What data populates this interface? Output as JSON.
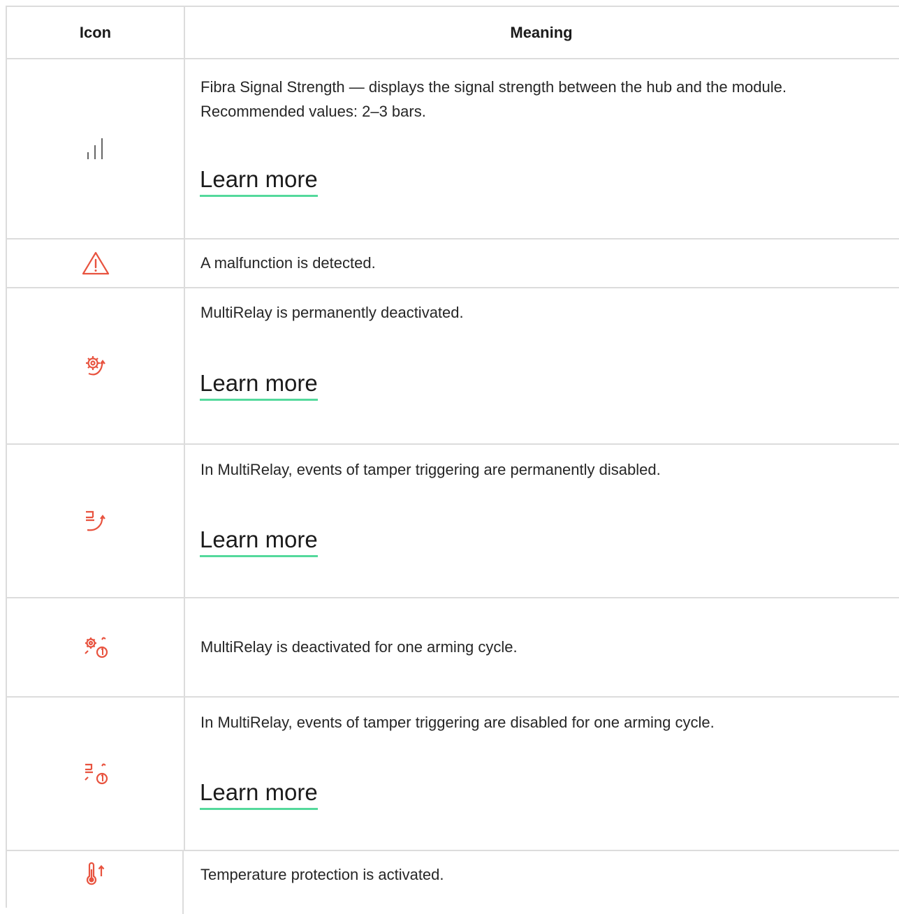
{
  "table": {
    "header": {
      "icon": "Icon",
      "meaning": "Meaning"
    },
    "rows": [
      {
        "icon": "signal-strength-icon",
        "text": "Fibra Signal Strength — displays the signal strength between the hub and the module. Recommended values: 2–3 bars.",
        "link": "Learn more"
      },
      {
        "icon": "warning-triangle-icon",
        "text": "A malfunction is detected."
      },
      {
        "icon": "gear-deactivated-icon",
        "text": "MultiRelay is permanently deactivated.",
        "link": "Learn more"
      },
      {
        "icon": "tamper-disabled-icon",
        "text": "In MultiRelay, events of tamper triggering are permanently disabled.",
        "link": "Learn more"
      },
      {
        "icon": "gear-one-cycle-icon",
        "text": "MultiRelay is deactivated for one arming cycle."
      },
      {
        "icon": "tamper-one-cycle-icon",
        "text": "In MultiRelay, events of tamper triggering are disabled for one arming cycle.",
        "link": "Learn more"
      },
      {
        "icon": "thermometer-up-icon",
        "text": "Temperature protection is activated."
      }
    ]
  },
  "colors": {
    "accent_red": "#e8533f",
    "link_underline": "#54d99c",
    "border": "#dcdcdc"
  }
}
